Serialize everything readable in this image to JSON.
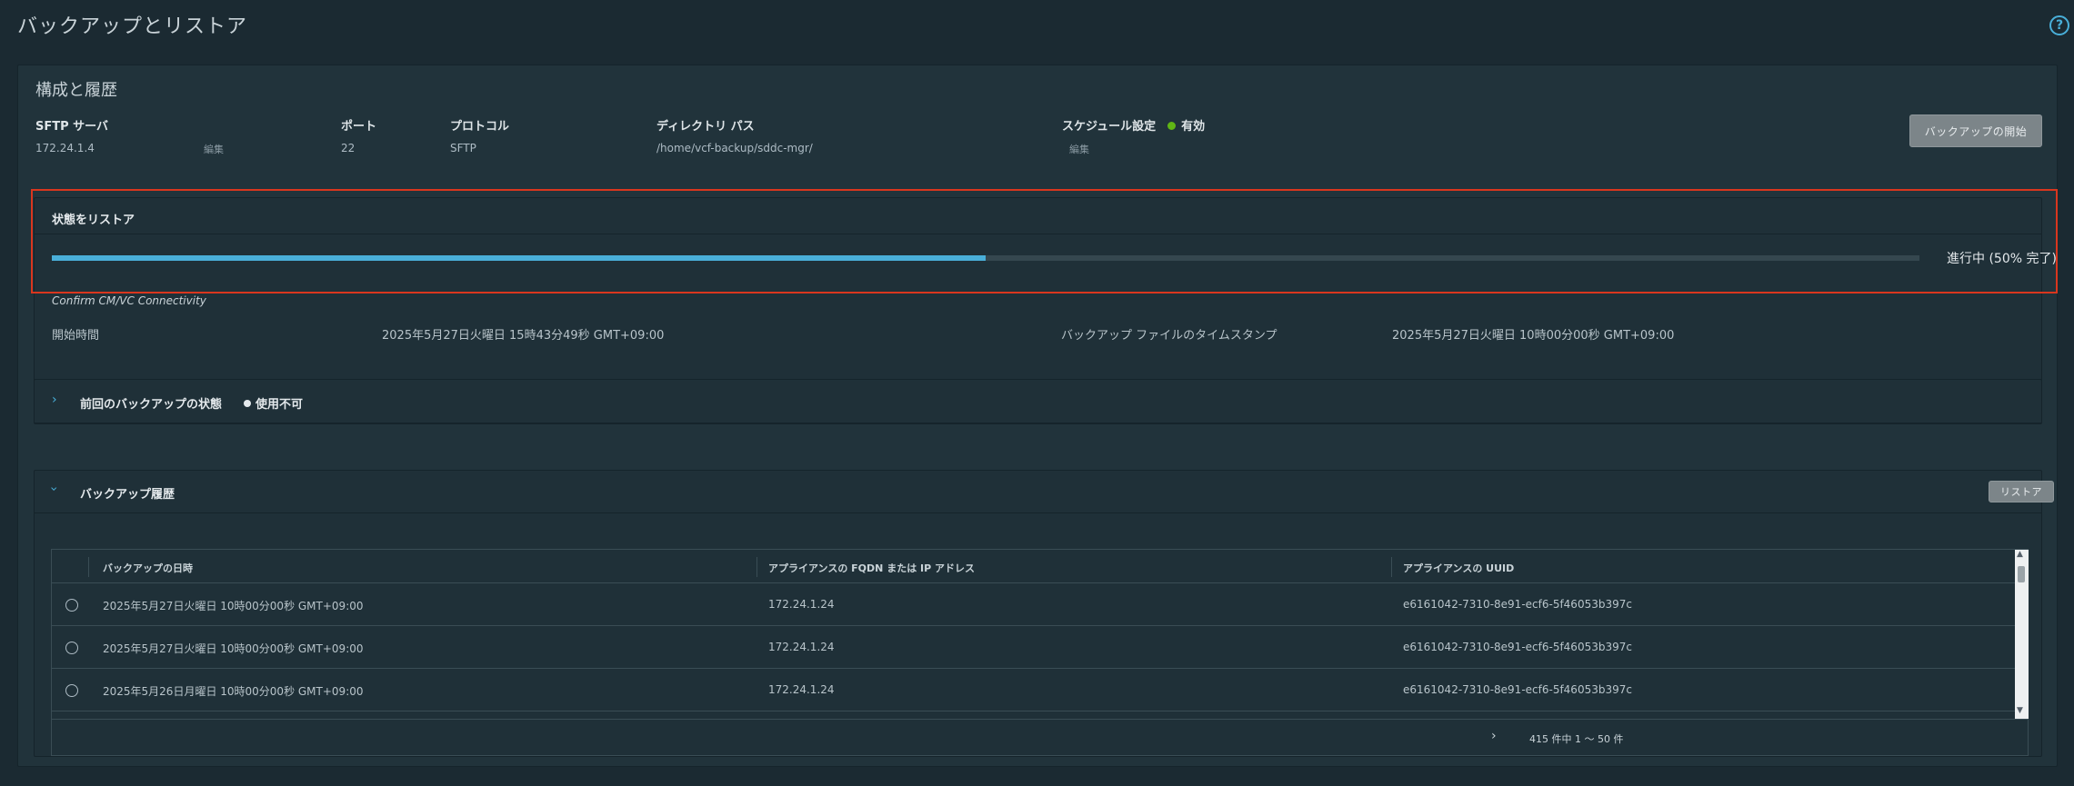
{
  "page": {
    "title": "バックアップとリストア",
    "help_icon": "help-circle-icon"
  },
  "config": {
    "title": "構成と履歴",
    "sftp_label": "SFTP サーバ",
    "sftp_value": "172.24.1.4",
    "sftp_edit": "編集",
    "port_label": "ポート",
    "port_value": "22",
    "protocol_label": "プロトコル",
    "protocol_value": "SFTP",
    "dir_label": "ディレクトリ パス",
    "dir_value": "/home/vcf-backup/sddc-mgr/",
    "schedule_label": "スケジュール設定",
    "schedule_status": "有効",
    "schedule_status_color": "#60b515",
    "schedule_edit": "編集",
    "start_backup_button": "バックアップの開始"
  },
  "restore": {
    "title": "状態をリストア",
    "progress_percent": 50,
    "progress_text": "進行中 (50% 完了)",
    "step": "Confirm CM/VC Connectivity",
    "start_time_label": "開始時間",
    "start_time_value": "2025年5月27日火曜日 15時43分49秒 GMT+09:00",
    "backup_ts_label": "バックアップ ファイルのタイムスタンプ",
    "backup_ts_value": "2025年5月27日火曜日 10時00分00秒 GMT+09:00"
  },
  "last_backup": {
    "title": "前回のバックアップの状態",
    "status": "使用不可"
  },
  "history": {
    "title": "バックアップ履歴",
    "restore_button": "リストア",
    "columns": [
      "バックアップの日時",
      "アプライアンスの FQDN または IP アドレス",
      "アプライアンスの UUID"
    ],
    "rows": [
      {
        "datetime": "2025年5月27日火曜日 10時00分00秒 GMT+09:00",
        "fqdn": "172.24.1.24",
        "uuid": "e6161042-7310-8e91-ecf6-5f46053b397c"
      },
      {
        "datetime": "2025年5月27日火曜日 10時00分00秒 GMT+09:00",
        "fqdn": "172.24.1.24",
        "uuid": "e6161042-7310-8e91-ecf6-5f46053b397c"
      },
      {
        "datetime": "2025年5月26日月曜日 10時00分00秒 GMT+09:00",
        "fqdn": "172.24.1.24",
        "uuid": "e6161042-7310-8e91-ecf6-5f46053b397c"
      }
    ],
    "pagination": "415 件中 1 ～ 50 件"
  },
  "colors": {
    "accent": "#49afd9",
    "highlight_border": "#d9361e",
    "background": "#1b2a32"
  }
}
